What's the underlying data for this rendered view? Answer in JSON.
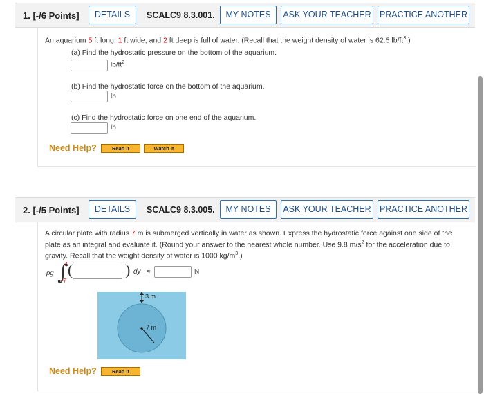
{
  "q1": {
    "number": "1. [-/6 Points]",
    "details": "DETAILS",
    "code": "SCALC9 8.3.001.",
    "my_notes": "MY NOTES",
    "ask_teacher": "ASK YOUR TEACHER",
    "practice": "PRACTICE ANOTHER",
    "intro": {
      "t1": "An aquarium ",
      "v1": "5",
      "t2": " ft long, ",
      "v2": "1",
      "t3": " ft wide, and ",
      "v3": "2",
      "t4": " ft deep is full of water. (Recall that the weight density of water is 62.5 lb/ft",
      "sup": "3",
      "t5": ".)"
    },
    "parts": [
      {
        "label": "(a) Find the hydrostatic pressure on the bottom of the aquarium.",
        "unit": "lb/ft",
        "unit_sup": "2"
      },
      {
        "label": "(b) Find the hydrostatic force on the bottom of the aquarium.",
        "unit": "lb",
        "unit_sup": ""
      },
      {
        "label": "(c) Find the hydrostatic force on one end of the aquarium.",
        "unit": "lb",
        "unit_sup": ""
      }
    ],
    "need_help": "Need Help?",
    "read_it": "Read It",
    "watch_it": "Watch It"
  },
  "q2": {
    "number": "2. [-/5 Points]",
    "details": "DETAILS",
    "code": "SCALC9 8.3.005.",
    "my_notes": "MY NOTES",
    "ask_teacher": "ASK YOUR TEACHER",
    "practice": "PRACTICE ANOTHER",
    "line1a": "A circular plate with radius ",
    "radius": "7",
    "line1b": " m  is submerged vertically in water as shown. Express the hydrostatic force against one side of the",
    "line2a": "plate as an integral and evaluate it. (Round your answer to the nearest whole number. Use 9.8 m/s",
    "line2sup": "2",
    "line2b": " for the acceleration due to",
    "line3a": "gravity. Recall that the weight density of water is 1000 kg/m",
    "line3sup": "3",
    "line3b": ".)",
    "rho_g": "ρg",
    "upper_limit": "7",
    "lower_limit": "−7",
    "dy": "dy",
    "approx": "≈",
    "unit": "N",
    "fig_depth_label": "3 m",
    "fig_radius_label": "7 m",
    "need_help": "Need Help?",
    "read_it": "Read It"
  },
  "colors": {
    "accent_blue": "#1f4f86",
    "value_red": "#c00000",
    "help_orange": "#f7b531",
    "water": "#8ccbe6"
  }
}
